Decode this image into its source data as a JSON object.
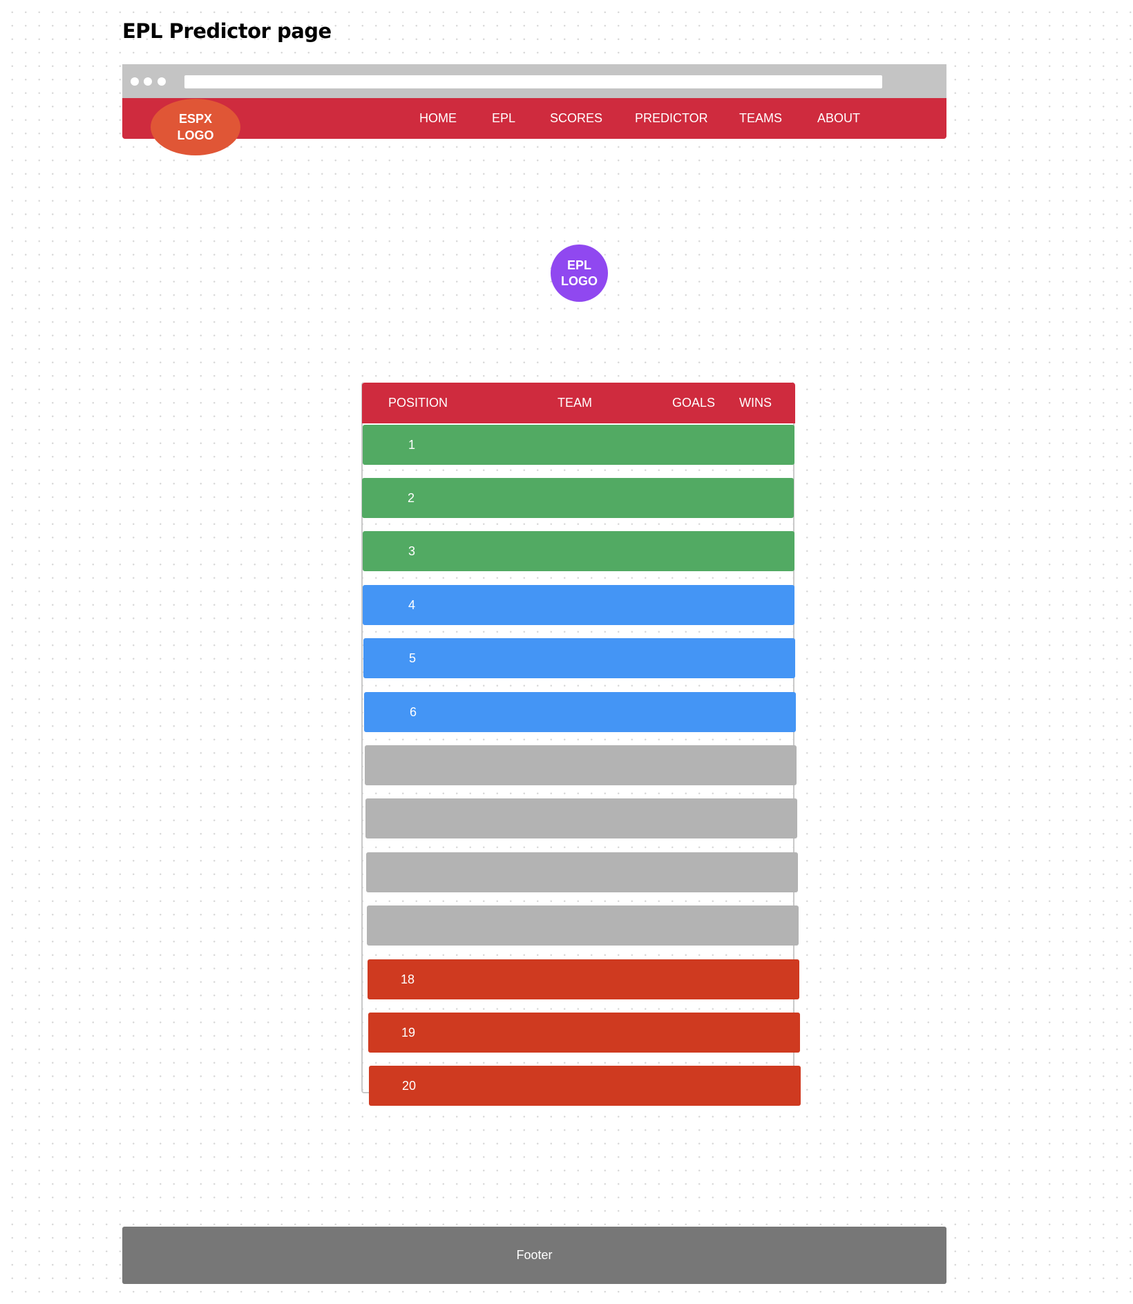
{
  "page_title": "EPL Predictor page",
  "navbar": {
    "logo": "ESPX\nLOGO",
    "items": [
      {
        "label": "HOME"
      },
      {
        "label": "EPL"
      },
      {
        "label": "SCORES"
      },
      {
        "label": "PREDICTOR"
      },
      {
        "label": "TEAMS"
      },
      {
        "label": "ABOUT"
      }
    ]
  },
  "epl_logo": "EPL\nLOGO",
  "table": {
    "headers": {
      "position": "POSITION",
      "team": "TEAM",
      "goals": "GOALS",
      "wins": "WINS"
    },
    "rows": [
      {
        "position": "1",
        "zone": "green"
      },
      {
        "position": "2",
        "zone": "green"
      },
      {
        "position": "3",
        "zone": "green"
      },
      {
        "position": "4",
        "zone": "blue"
      },
      {
        "position": "5",
        "zone": "blue"
      },
      {
        "position": "6",
        "zone": "blue"
      },
      {
        "position": "",
        "zone": "gray"
      },
      {
        "position": "",
        "zone": "gray"
      },
      {
        "position": "",
        "zone": "gray"
      },
      {
        "position": "",
        "zone": "gray"
      },
      {
        "position": "18",
        "zone": "red"
      },
      {
        "position": "19",
        "zone": "red"
      },
      {
        "position": "20",
        "zone": "red"
      }
    ]
  },
  "footer": "Footer",
  "colors": {
    "nav_red": "#cf2b3e",
    "espx_logo": "#e05636",
    "epl_logo": "#9048f0",
    "green": "#52aa63",
    "blue": "#4495f5",
    "gray": "#b3b3b3",
    "red": "#cf3a20",
    "footer": "#777777"
  }
}
